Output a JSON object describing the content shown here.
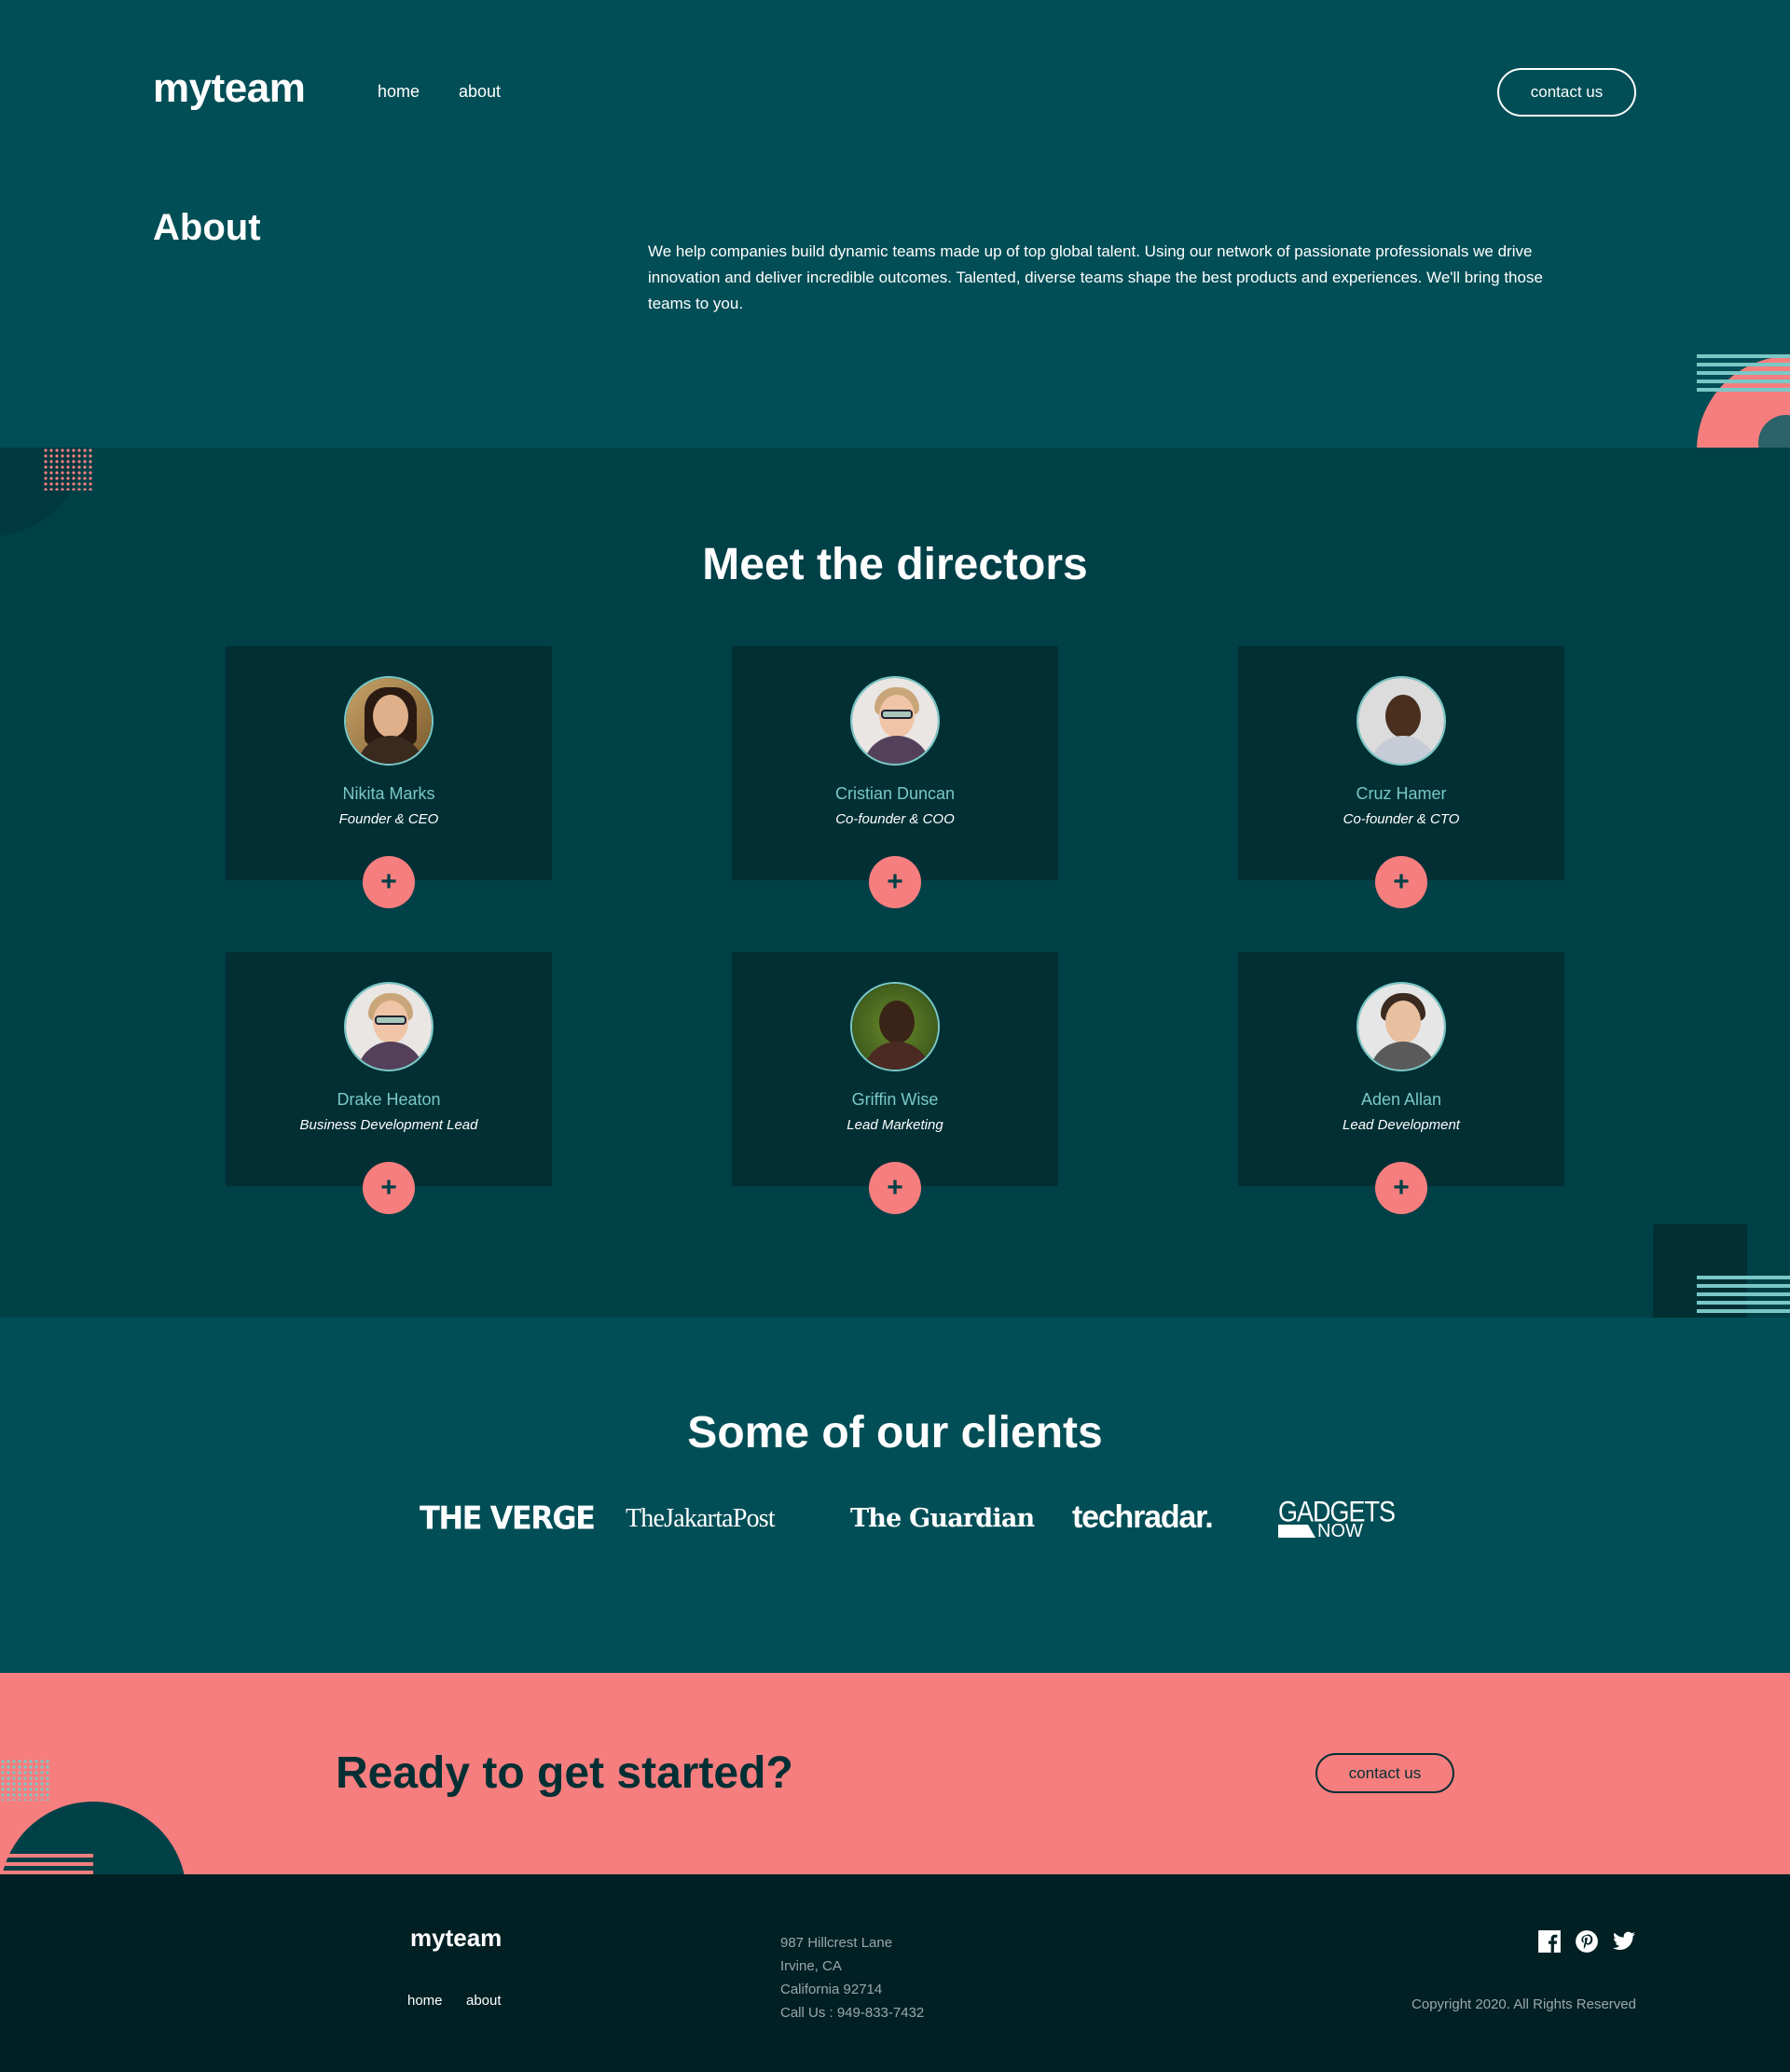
{
  "header": {
    "logo": "myteam",
    "nav": {
      "home": "home",
      "about": "about"
    },
    "cta_label": "contact us"
  },
  "about": {
    "title": "About",
    "text": "We help companies build dynamic teams made up of top global talent. Using our network of passionate professionals we drive innovation and deliver incredible outcomes. Talented, diverse teams shape the best products and experiences. We'll bring those teams to you."
  },
  "directors": {
    "title": "Meet the directors",
    "items": [
      {
        "name": "Nikita Marks",
        "role": "Founder & CEO"
      },
      {
        "name": "Cristian Duncan",
        "role": "Co-founder & COO"
      },
      {
        "name": "Cruz Hamer",
        "role": "Co-founder & CTO"
      },
      {
        "name": "Drake Heaton",
        "role": "Business Development Lead"
      },
      {
        "name": "Griffin Wise",
        "role": "Lead Marketing"
      },
      {
        "name": "Aden Allan",
        "role": "Lead Development"
      }
    ],
    "expand_label": "+"
  },
  "clients": {
    "title": "Some of our clients",
    "logos": {
      "verge": "THE VERGE",
      "jakarta": "TheJakartaPost",
      "guardian": "The Guardian",
      "techradar": "techradar.",
      "gadgets_top": "GADGETS",
      "gadgets_bottom": "NOW"
    }
  },
  "cta": {
    "title": "Ready to get started?",
    "button_label": "contact us"
  },
  "footer": {
    "logo": "myteam",
    "nav": {
      "home": "home",
      "about": "about"
    },
    "address": {
      "line1": "987 Hillcrest Lane",
      "line2": "Irvine, CA",
      "line3": "California 92714",
      "line4": "Call Us : 949-833-7432"
    },
    "social": [
      "facebook-icon",
      "pinterest-icon",
      "twitter-icon"
    ],
    "copyright": "Copyright 2020. All Rights Reserved"
  },
  "colors": {
    "hero_bg": "#014E56",
    "section_bg": "#004047",
    "card_bg": "#012F34",
    "accent_coral": "#F67E7E",
    "accent_teal": "#79C8C7",
    "footer_bg": "#012024"
  }
}
